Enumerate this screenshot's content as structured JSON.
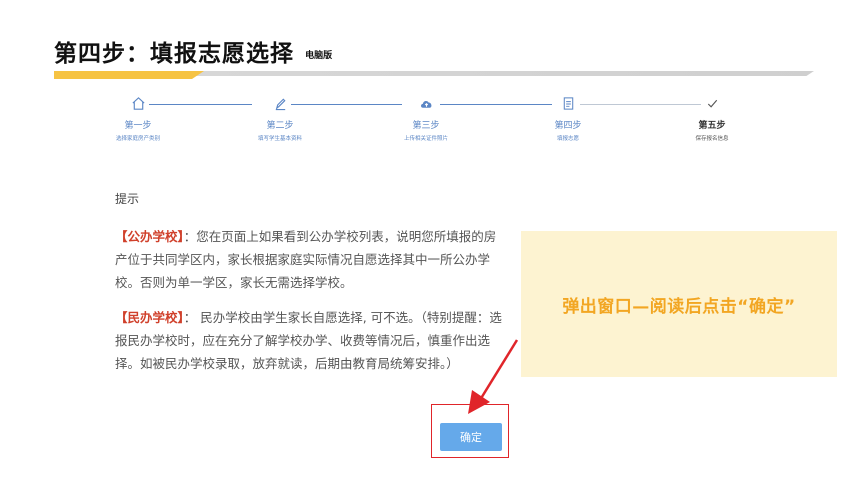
{
  "header": {
    "title": "第四步：填报志愿选择",
    "subtitle": "电脑版"
  },
  "stepper": {
    "steps": [
      {
        "name": "第一步",
        "desc": "选择家庭房产类别",
        "icon": "home-icon"
      },
      {
        "name": "第二步",
        "desc": "填写学生基本资料",
        "icon": "pencil-icon"
      },
      {
        "name": "第三步",
        "desc": "上传相关证件照片",
        "icon": "cloud-upload-icon"
      },
      {
        "name": "第四步",
        "desc": "填报志愿",
        "icon": "document-icon"
      },
      {
        "name": "第五步",
        "desc": "保存报名信息",
        "icon": "check-icon"
      }
    ]
  },
  "dialog": {
    "hint_title": "提示",
    "public_tag": "【公办学校】",
    "public_text": "：您在页面上如果看到公办学校列表，说明您所填报的房产位于共同学区内，家长根据家庭实际情况自愿选择其中一所公办学校。否则为单一学区，家长无需选择学校。",
    "private_tag": "【民办学校】",
    "private_text": "： 民办学校由学生家长自愿选择, 可不选。（特别提醒：选报民办学校时，应在充分了解学校办学、收费等情况后，慎重作出选择。如被民办学校录取，放弃就读，后期由教育局统筹安排。）",
    "confirm_label": "确定"
  },
  "callout": {
    "text": "弹出窗口—阅读后点击“确定”"
  },
  "colors": {
    "accent_blue": "#5b86c5",
    "button_blue": "#65a9ea",
    "highlight_red": "#e0252a",
    "callout_bg": "#fdf3d1",
    "callout_text": "#f2a623",
    "title_accent": "#f6c343"
  }
}
